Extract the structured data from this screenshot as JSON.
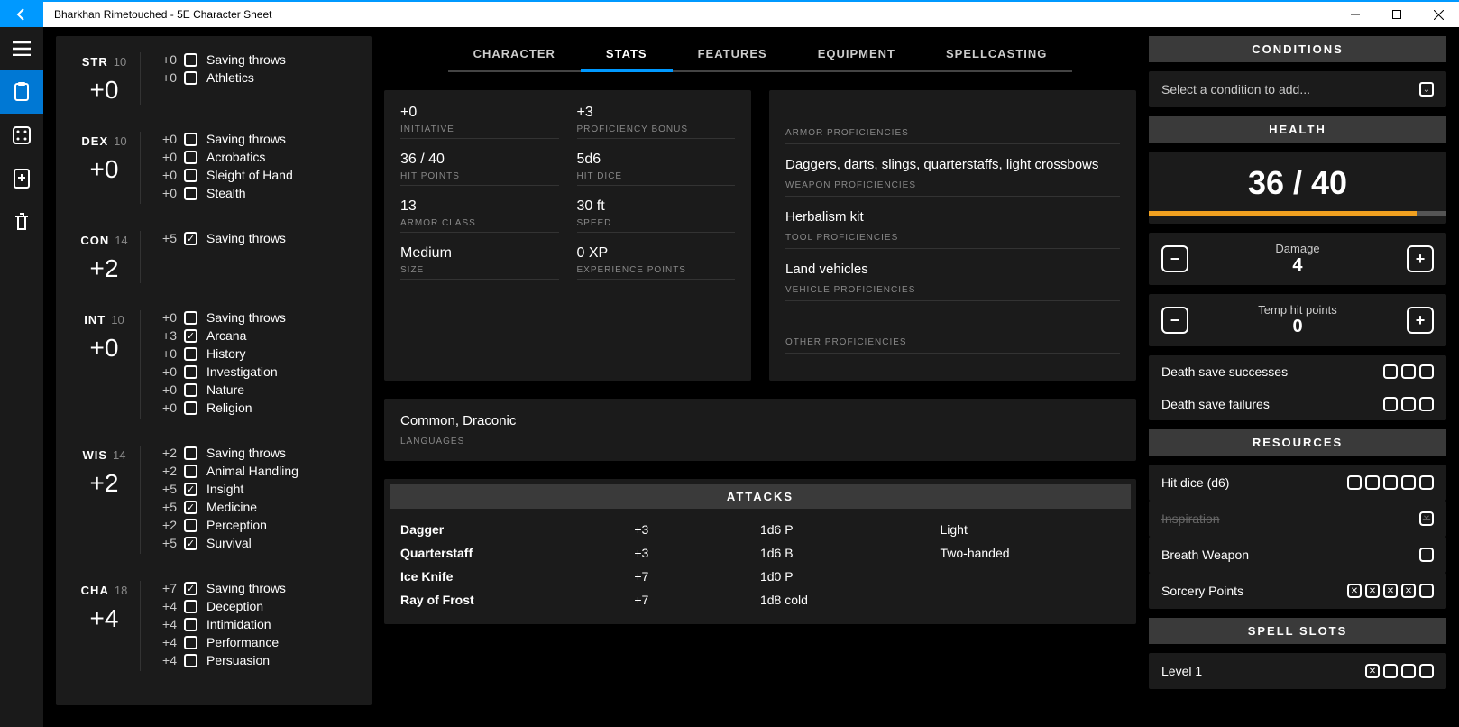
{
  "window": {
    "title": "Bharkhan Rimetouched - 5E Character Sheet"
  },
  "tabs": [
    "CHARACTER",
    "STATS",
    "FEATURES",
    "EQUIPMENT",
    "SPELLCASTING"
  ],
  "activeTab": "STATS",
  "abilities": [
    {
      "abbr": "STR",
      "score": "10",
      "mod": "+0",
      "skills": [
        {
          "mod": "+0",
          "prof": false,
          "name": "Saving throws"
        },
        {
          "mod": "+0",
          "prof": false,
          "name": "Athletics"
        }
      ]
    },
    {
      "abbr": "DEX",
      "score": "10",
      "mod": "+0",
      "skills": [
        {
          "mod": "+0",
          "prof": false,
          "name": "Saving throws"
        },
        {
          "mod": "+0",
          "prof": false,
          "name": "Acrobatics"
        },
        {
          "mod": "+0",
          "prof": false,
          "name": "Sleight of Hand"
        },
        {
          "mod": "+0",
          "prof": false,
          "name": "Stealth"
        }
      ]
    },
    {
      "abbr": "CON",
      "score": "14",
      "mod": "+2",
      "skills": [
        {
          "mod": "+5",
          "prof": true,
          "name": "Saving throws"
        }
      ]
    },
    {
      "abbr": "INT",
      "score": "10",
      "mod": "+0",
      "skills": [
        {
          "mod": "+0",
          "prof": false,
          "name": "Saving throws"
        },
        {
          "mod": "+3",
          "prof": true,
          "name": "Arcana"
        },
        {
          "mod": "+0",
          "prof": false,
          "name": "History"
        },
        {
          "mod": "+0",
          "prof": false,
          "name": "Investigation"
        },
        {
          "mod": "+0",
          "prof": false,
          "name": "Nature"
        },
        {
          "mod": "+0",
          "prof": false,
          "name": "Religion"
        }
      ]
    },
    {
      "abbr": "WIS",
      "score": "14",
      "mod": "+2",
      "skills": [
        {
          "mod": "+2",
          "prof": false,
          "name": "Saving throws"
        },
        {
          "mod": "+2",
          "prof": false,
          "name": "Animal Handling"
        },
        {
          "mod": "+5",
          "prof": true,
          "name": "Insight"
        },
        {
          "mod": "+5",
          "prof": true,
          "name": "Medicine"
        },
        {
          "mod": "+2",
          "prof": false,
          "name": "Perception"
        },
        {
          "mod": "+5",
          "prof": true,
          "name": "Survival"
        }
      ]
    },
    {
      "abbr": "CHA",
      "score": "18",
      "mod": "+4",
      "skills": [
        {
          "mod": "+7",
          "prof": true,
          "name": "Saving throws"
        },
        {
          "mod": "+4",
          "prof": false,
          "name": "Deception"
        },
        {
          "mod": "+4",
          "prof": false,
          "name": "Intimidation"
        },
        {
          "mod": "+4",
          "prof": false,
          "name": "Performance"
        },
        {
          "mod": "+4",
          "prof": false,
          "name": "Persuasion"
        }
      ]
    }
  ],
  "stats": {
    "initiative": {
      "val": "+0",
      "lbl": "INITIATIVE"
    },
    "profBonus": {
      "val": "+3",
      "lbl": "PROFICIENCY BONUS"
    },
    "hp": {
      "val": "36 / 40",
      "lbl": "HIT POINTS"
    },
    "hitDice": {
      "val": "5d6",
      "lbl": "HIT DICE"
    },
    "ac": {
      "val": "13",
      "lbl": "ARMOR CLASS"
    },
    "speed": {
      "val": "30 ft",
      "lbl": "SPEED"
    },
    "size": {
      "val": "Medium",
      "lbl": "SIZE"
    },
    "xp": {
      "val": "0 XP",
      "lbl": "EXPERIENCE POINTS"
    }
  },
  "profs": {
    "armor": {
      "val": "",
      "lbl": "ARMOR PROFICIENCIES"
    },
    "weapon": {
      "val": "Daggers, darts, slings, quarterstaffs, light crossbows",
      "lbl": "WEAPON PROFICIENCIES"
    },
    "tool": {
      "val": "Herbalism kit",
      "lbl": "TOOL PROFICIENCIES"
    },
    "vehicle": {
      "val": "Land vehicles",
      "lbl": "VEHICLE PROFICIENCIES"
    },
    "other": {
      "val": "",
      "lbl": "OTHER PROFICIENCIES"
    }
  },
  "languages": {
    "val": "Common, Draconic",
    "lbl": "LANGUAGES"
  },
  "attacksHeader": "ATTACKS",
  "attacks": [
    {
      "name": "Dagger",
      "bonus": "+3",
      "dmg": "1d6 P",
      "prop": "Light"
    },
    {
      "name": "Quarterstaff",
      "bonus": "+3",
      "dmg": "1d6 B",
      "prop": "Two-handed"
    },
    {
      "name": "Ice Knife",
      "bonus": "+7",
      "dmg": "1d0 P",
      "prop": ""
    },
    {
      "name": "Ray of Frost",
      "bonus": "+7",
      "dmg": "1d8 cold",
      "prop": ""
    }
  ],
  "right": {
    "conditionsHeader": "CONDITIONS",
    "condPlaceholder": "Select a condition to add...",
    "healthHeader": "HEALTH",
    "hpCur": "36",
    "hpSep": "/",
    "hpMax": "40",
    "damageLabel": "Damage",
    "damageVal": "4",
    "tempLabel": "Temp hit points",
    "tempVal": "0",
    "dsSuccess": "Death save successes",
    "dsFail": "Death save failures",
    "resourcesHeader": "RESOURCES",
    "res": [
      {
        "name": "Hit dice (d6)",
        "boxes": 5,
        "used": 0,
        "dis": false
      },
      {
        "name": "Inspiration",
        "boxes": 1,
        "used": 1,
        "dis": true
      },
      {
        "name": "Breath Weapon",
        "boxes": 1,
        "used": 0,
        "dis": false
      },
      {
        "name": "Sorcery Points",
        "boxes": 5,
        "used": 4,
        "dis": false
      }
    ],
    "spellSlotsHeader": "SPELL SLOTS",
    "slots": [
      {
        "name": "Level 1",
        "boxes": 4,
        "used": 1,
        "dis": false
      }
    ]
  }
}
